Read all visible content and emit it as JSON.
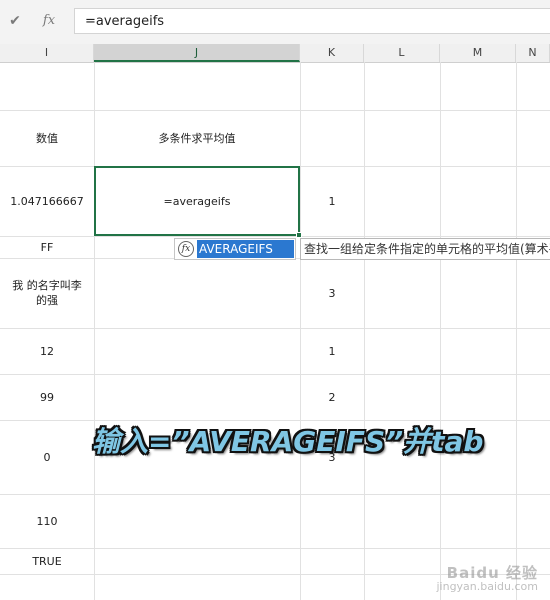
{
  "formula_bar": {
    "cancel_icon": "✔",
    "fx_label": "fx",
    "formula": "=averageifs"
  },
  "columns": [
    {
      "label": "I",
      "active": false
    },
    {
      "label": "J",
      "active": true
    },
    {
      "label": "K",
      "active": false
    },
    {
      "label": "L",
      "active": false
    },
    {
      "label": "M",
      "active": false
    },
    {
      "label": "N",
      "active": false
    }
  ],
  "cells": {
    "I_header": "数值",
    "J_header": "多条件求平均值",
    "I1": "1.047166667",
    "J1": "=averageifs",
    "K1": "1",
    "I2": "FF",
    "I3": "我    的名字叫李的强",
    "K3": "3",
    "I4": "12",
    "K4": "1",
    "I5": "99",
    "K5": "2",
    "I6": "0",
    "K6": "3",
    "I7": "110",
    "I8": "TRUE"
  },
  "autocomplete": {
    "icon": "fx",
    "function_name": "AVERAGEIFS",
    "tooltip": "查找一组给定条件指定的单元格的平均值(算术平均值)"
  },
  "caption": "输入=”AVERAGEIFS”并tab",
  "watermark": {
    "logo": "Baidu 经验",
    "url": "jingyan.baidu.com"
  },
  "colors": {
    "accent_green": "#217346",
    "autocomplete_highlight": "#2b78d0",
    "caption_fill": "#7fc6e4"
  }
}
